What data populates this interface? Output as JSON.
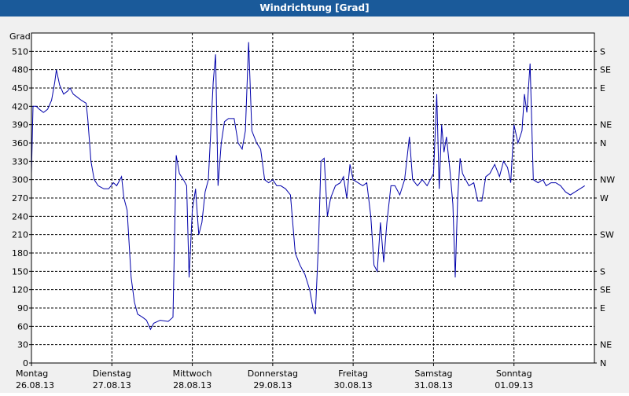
{
  "window": {
    "title": "Windrichtung [Grad]"
  },
  "chart_data": {
    "type": "line",
    "title": "Windrichtung [Grad]",
    "ylabel": "Grad",
    "ylim": [
      0,
      540
    ],
    "yticks": [
      0,
      30,
      60,
      90,
      120,
      150,
      180,
      210,
      240,
      270,
      300,
      330,
      360,
      390,
      420,
      450,
      480,
      510
    ],
    "right_ticks": [
      {
        "label": "N",
        "value": 0
      },
      {
        "label": "NE",
        "value": 30
      },
      {
        "label": "E",
        "value": 90
      },
      {
        "label": "SE",
        "value": 120
      },
      {
        "label": "S",
        "value": 150
      },
      {
        "label": "SW",
        "value": 210
      },
      {
        "label": "W",
        "value": 270
      },
      {
        "label": "NW",
        "value": 300
      },
      {
        "label": "N",
        "value": 360
      },
      {
        "label": "NE",
        "value": 390
      },
      {
        "label": "E",
        "value": 450
      },
      {
        "label": "SE",
        "value": 480
      },
      {
        "label": "S",
        "value": 510
      }
    ],
    "xlim": [
      0,
      7
    ],
    "days": [
      {
        "day": "Montag",
        "date": "26.08.13"
      },
      {
        "day": "Dienstag",
        "date": "27.08.13"
      },
      {
        "day": "Mittwoch",
        "date": "28.08.13"
      },
      {
        "day": "Donnerstag",
        "date": "29.08.13"
      },
      {
        "day": "Freitag",
        "date": "30.08.13"
      },
      {
        "day": "Samstag",
        "date": "31.08.13"
      },
      {
        "day": "Sonntag",
        "date": "01.09.13"
      }
    ],
    "grid": true,
    "line_color": "#0000aa",
    "series": [
      {
        "points": [
          [
            0.0,
            310
          ],
          [
            0.02,
            420
          ],
          [
            0.06,
            420
          ],
          [
            0.1,
            415
          ],
          [
            0.15,
            410
          ],
          [
            0.2,
            415
          ],
          [
            0.25,
            430
          ],
          [
            0.29,
            460
          ],
          [
            0.31,
            480
          ],
          [
            0.35,
            455
          ],
          [
            0.4,
            440
          ],
          [
            0.45,
            445
          ],
          [
            0.48,
            450
          ],
          [
            0.52,
            440
          ],
          [
            0.57,
            435
          ],
          [
            0.62,
            430
          ],
          [
            0.68,
            425
          ],
          [
            0.7,
            400
          ],
          [
            0.74,
            330
          ],
          [
            0.78,
            300
          ],
          [
            0.83,
            290
          ],
          [
            0.9,
            285
          ],
          [
            0.96,
            285
          ],
          [
            1.02,
            295
          ],
          [
            1.06,
            290
          ],
          [
            1.12,
            305
          ],
          [
            1.15,
            270
          ],
          [
            1.19,
            250
          ],
          [
            1.24,
            140
          ],
          [
            1.28,
            100
          ],
          [
            1.32,
            80
          ],
          [
            1.38,
            75
          ],
          [
            1.43,
            70
          ],
          [
            1.48,
            55
          ],
          [
            1.52,
            65
          ],
          [
            1.6,
            70
          ],
          [
            1.7,
            68
          ],
          [
            1.76,
            75
          ],
          [
            1.8,
            340
          ],
          [
            1.84,
            310
          ],
          [
            1.89,
            300
          ],
          [
            1.93,
            290
          ],
          [
            1.96,
            140
          ],
          [
            2.0,
            250
          ],
          [
            2.04,
            285
          ],
          [
            2.08,
            210
          ],
          [
            2.12,
            230
          ],
          [
            2.16,
            280
          ],
          [
            2.2,
            300
          ],
          [
            2.26,
            460
          ],
          [
            2.29,
            505
          ],
          [
            2.32,
            290
          ],
          [
            2.36,
            360
          ],
          [
            2.4,
            395
          ],
          [
            2.45,
            400
          ],
          [
            2.52,
            400
          ],
          [
            2.57,
            360
          ],
          [
            2.62,
            350
          ],
          [
            2.66,
            380
          ],
          [
            2.7,
            525
          ],
          [
            2.74,
            380
          ],
          [
            2.8,
            360
          ],
          [
            2.85,
            350
          ],
          [
            2.9,
            300
          ],
          [
            2.95,
            295
          ],
          [
            3.0,
            300
          ],
          [
            3.05,
            290
          ],
          [
            3.1,
            290
          ],
          [
            3.16,
            285
          ],
          [
            3.22,
            275
          ],
          [
            3.28,
            180
          ],
          [
            3.34,
            160
          ],
          [
            3.4,
            145
          ],
          [
            3.46,
            120
          ],
          [
            3.5,
            90
          ],
          [
            3.53,
            80
          ],
          [
            3.57,
            200
          ],
          [
            3.6,
            330
          ],
          [
            3.64,
            335
          ],
          [
            3.68,
            240
          ],
          [
            3.72,
            270
          ],
          [
            3.78,
            290
          ],
          [
            3.84,
            295
          ],
          [
            3.88,
            305
          ],
          [
            3.92,
            270
          ],
          [
            3.96,
            325
          ],
          [
            4.0,
            300
          ],
          [
            4.06,
            295
          ],
          [
            4.12,
            290
          ],
          [
            4.17,
            295
          ],
          [
            4.22,
            240
          ],
          [
            4.26,
            160
          ],
          [
            4.3,
            150
          ],
          [
            4.34,
            230
          ],
          [
            4.38,
            165
          ],
          [
            4.42,
            230
          ],
          [
            4.47,
            290
          ],
          [
            4.52,
            290
          ],
          [
            4.58,
            275
          ],
          [
            4.64,
            300
          ],
          [
            4.7,
            370
          ],
          [
            4.74,
            300
          ],
          [
            4.8,
            290
          ],
          [
            4.86,
            300
          ],
          [
            4.92,
            290
          ],
          [
            4.96,
            300
          ],
          [
            5.0,
            310
          ],
          [
            5.04,
            440
          ],
          [
            5.07,
            285
          ],
          [
            5.1,
            390
          ],
          [
            5.13,
            345
          ],
          [
            5.16,
            370
          ],
          [
            5.2,
            320
          ],
          [
            5.24,
            260
          ],
          [
            5.27,
            140
          ],
          [
            5.3,
            270
          ],
          [
            5.33,
            335
          ],
          [
            5.36,
            310
          ],
          [
            5.4,
            300
          ],
          [
            5.44,
            290
          ],
          [
            5.5,
            295
          ],
          [
            5.55,
            265
          ],
          [
            5.6,
            265
          ],
          [
            5.65,
            305
          ],
          [
            5.7,
            310
          ],
          [
            5.76,
            325
          ],
          [
            5.82,
            305
          ],
          [
            5.87,
            330
          ],
          [
            5.92,
            320
          ],
          [
            5.96,
            295
          ],
          [
            6.0,
            390
          ],
          [
            6.05,
            360
          ],
          [
            6.1,
            380
          ],
          [
            6.13,
            440
          ],
          [
            6.16,
            410
          ],
          [
            6.2,
            490
          ],
          [
            6.24,
            300
          ],
          [
            6.3,
            295
          ],
          [
            6.36,
            300
          ],
          [
            6.4,
            290
          ],
          [
            6.46,
            295
          ],
          [
            6.52,
            295
          ],
          [
            6.58,
            290
          ],
          [
            6.64,
            280
          ],
          [
            6.7,
            275
          ],
          [
            6.76,
            280
          ],
          [
            6.82,
            285
          ],
          [
            6.88,
            290
          ]
        ]
      }
    ]
  }
}
